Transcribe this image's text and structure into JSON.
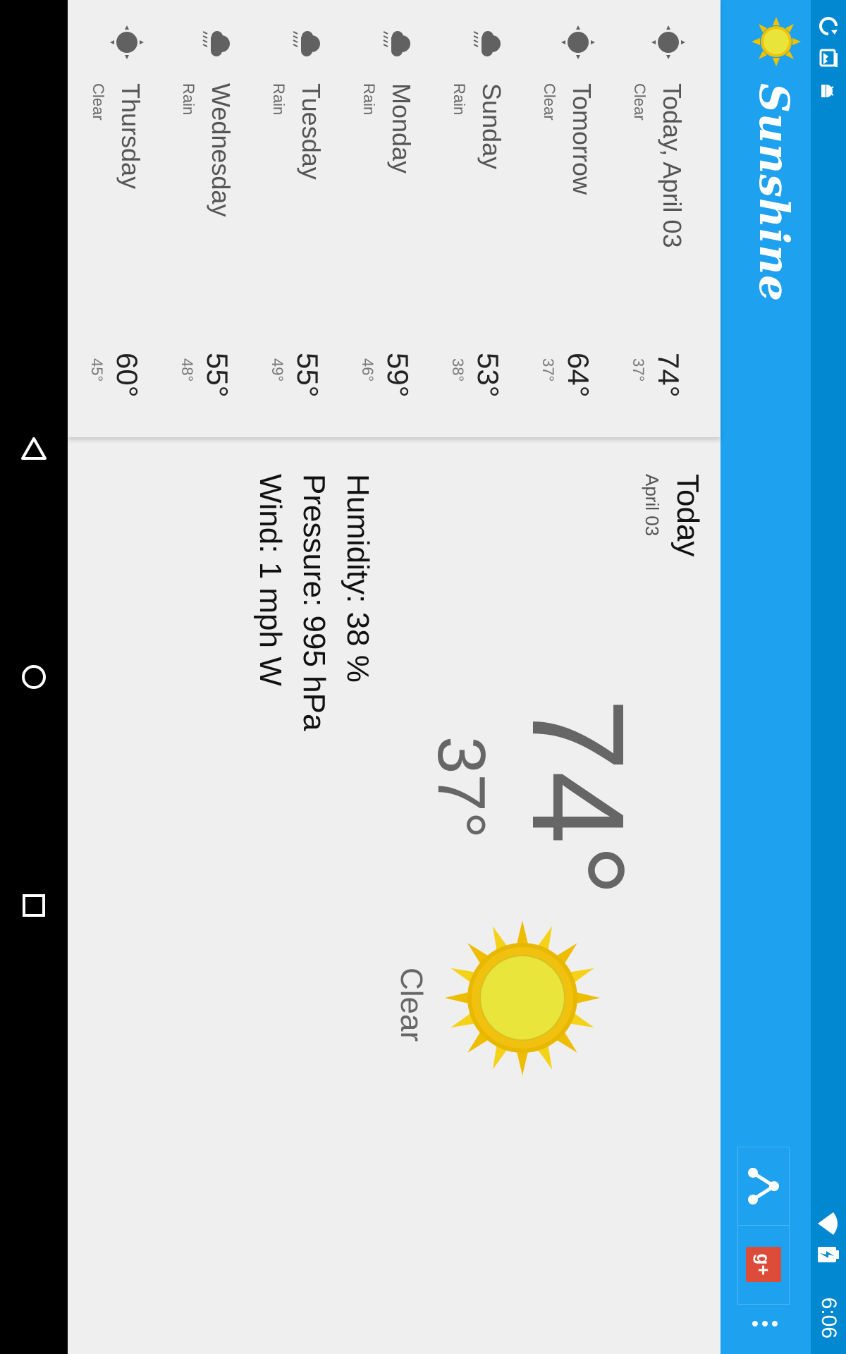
{
  "status_bar": {
    "time": "6:06",
    "icons": [
      "wifi-icon",
      "battery-icon",
      "sync-icon",
      "photo-notification-icon",
      "android-notification-icon"
    ]
  },
  "app_bar": {
    "title": "Sunshine",
    "logo_icon": "sun-icon",
    "share_icon": "share-icon",
    "gplus_label": "g+",
    "overflow_icon": "overflow-dots-icon",
    "colors": {
      "status": "#0288d1",
      "bar": "#1ea1ee"
    }
  },
  "forecast": [
    {
      "day": "Today, April 03",
      "desc": "Clear",
      "high": "74°",
      "low": "37°",
      "icon": "clear-icon"
    },
    {
      "day": "Tomorrow",
      "desc": "Clear",
      "high": "64°",
      "low": "37°",
      "icon": "clear-icon"
    },
    {
      "day": "Sunday",
      "desc": "Rain",
      "high": "53°",
      "low": "38°",
      "icon": "rain-icon"
    },
    {
      "day": "Monday",
      "desc": "Rain",
      "high": "59°",
      "low": "46°",
      "icon": "rain-icon"
    },
    {
      "day": "Tuesday",
      "desc": "Rain",
      "high": "55°",
      "low": "49°",
      "icon": "rain-icon"
    },
    {
      "day": "Wednesday",
      "desc": "Rain",
      "high": "55°",
      "low": "48°",
      "icon": "rain-icon"
    },
    {
      "day": "Thursday",
      "desc": "Clear",
      "high": "60°",
      "low": "45°",
      "icon": "clear-icon"
    }
  ],
  "detail": {
    "day": "Today",
    "date": "April 03",
    "high": "74°",
    "low": "37°",
    "desc": "Clear",
    "art": "sun-art",
    "humidity": "Humidity: 38 %",
    "pressure": "Pressure: 995 hPa",
    "wind": "Wind: 1 mph W"
  },
  "nav_bar": {
    "icons": [
      "back-icon",
      "home-icon",
      "recents-icon"
    ]
  }
}
